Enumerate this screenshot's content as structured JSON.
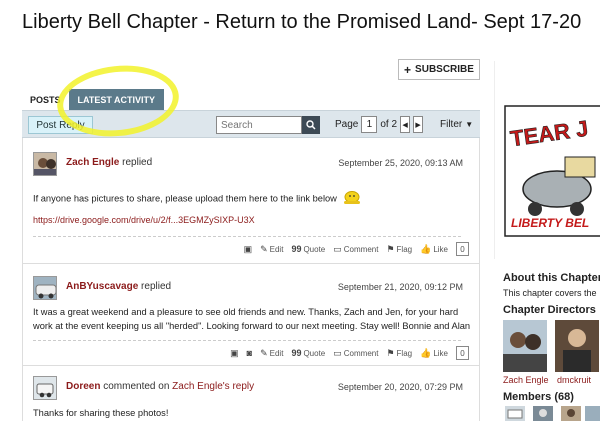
{
  "page": {
    "title": "Liberty Bell Chapter - Return to the Promised Land- Sept 17-20"
  },
  "subscribe": {
    "label": "SUBSCRIBE"
  },
  "tabs": [
    {
      "label": "POSTS",
      "active": false
    },
    {
      "label": "LATEST ACTIVITY",
      "active": true
    }
  ],
  "toolbar": {
    "post_reply": "Post Reply",
    "search_placeholder": "Search",
    "page_label": "Page",
    "page_current": "1",
    "page_of": "of 2",
    "filter_label": "Filter"
  },
  "actions_labels": {
    "edit": "Edit",
    "quote": "Quote",
    "comment": "Comment",
    "flag": "Flag",
    "like": "Like"
  },
  "entries": [
    {
      "author": "Zach Engle",
      "action": "replied",
      "date": "September 25, 2020, 09:13 AM",
      "text": "If anyone has pictures to share, please upload them here to the link below",
      "url": "https://drive.google.com/drive/u/2/f...3EGMZySIXP-U3X",
      "likes": "0"
    },
    {
      "author": "AnBYuscavage",
      "action": "replied",
      "date": "September 21, 2020, 09:12 PM",
      "text": "It was a great weekend and a pleasure to see old friends and new. Thanks, Zach and Jen, for your hard work at the event keeping us all \"herded\". Looking forward to our next meeting. Stay well! Bonnie and Alan",
      "likes": "0"
    },
    {
      "author": "Doreen",
      "action": "commented on",
      "target": "Zach Engle",
      "target_suffix": "'s reply",
      "date": "September 20, 2020, 07:29 PM",
      "text": "Thanks for sharing these photos!"
    }
  ],
  "sidebar": {
    "logo_text": "TEAR J",
    "logo_sub": "LIBERTY BEL",
    "about_title": "About this Chapter",
    "about_text": "This chapter covers the",
    "directors_title": "Chapter Directors",
    "directors": [
      "Zach Engle",
      "dmckruit"
    ],
    "members_title": "Members (68)"
  },
  "colors": {
    "accent": "#8b1a1a",
    "tab_active": "#5b7a8a",
    "toolbar_bg": "#dde6ec",
    "highlight": "#f2f22a"
  }
}
